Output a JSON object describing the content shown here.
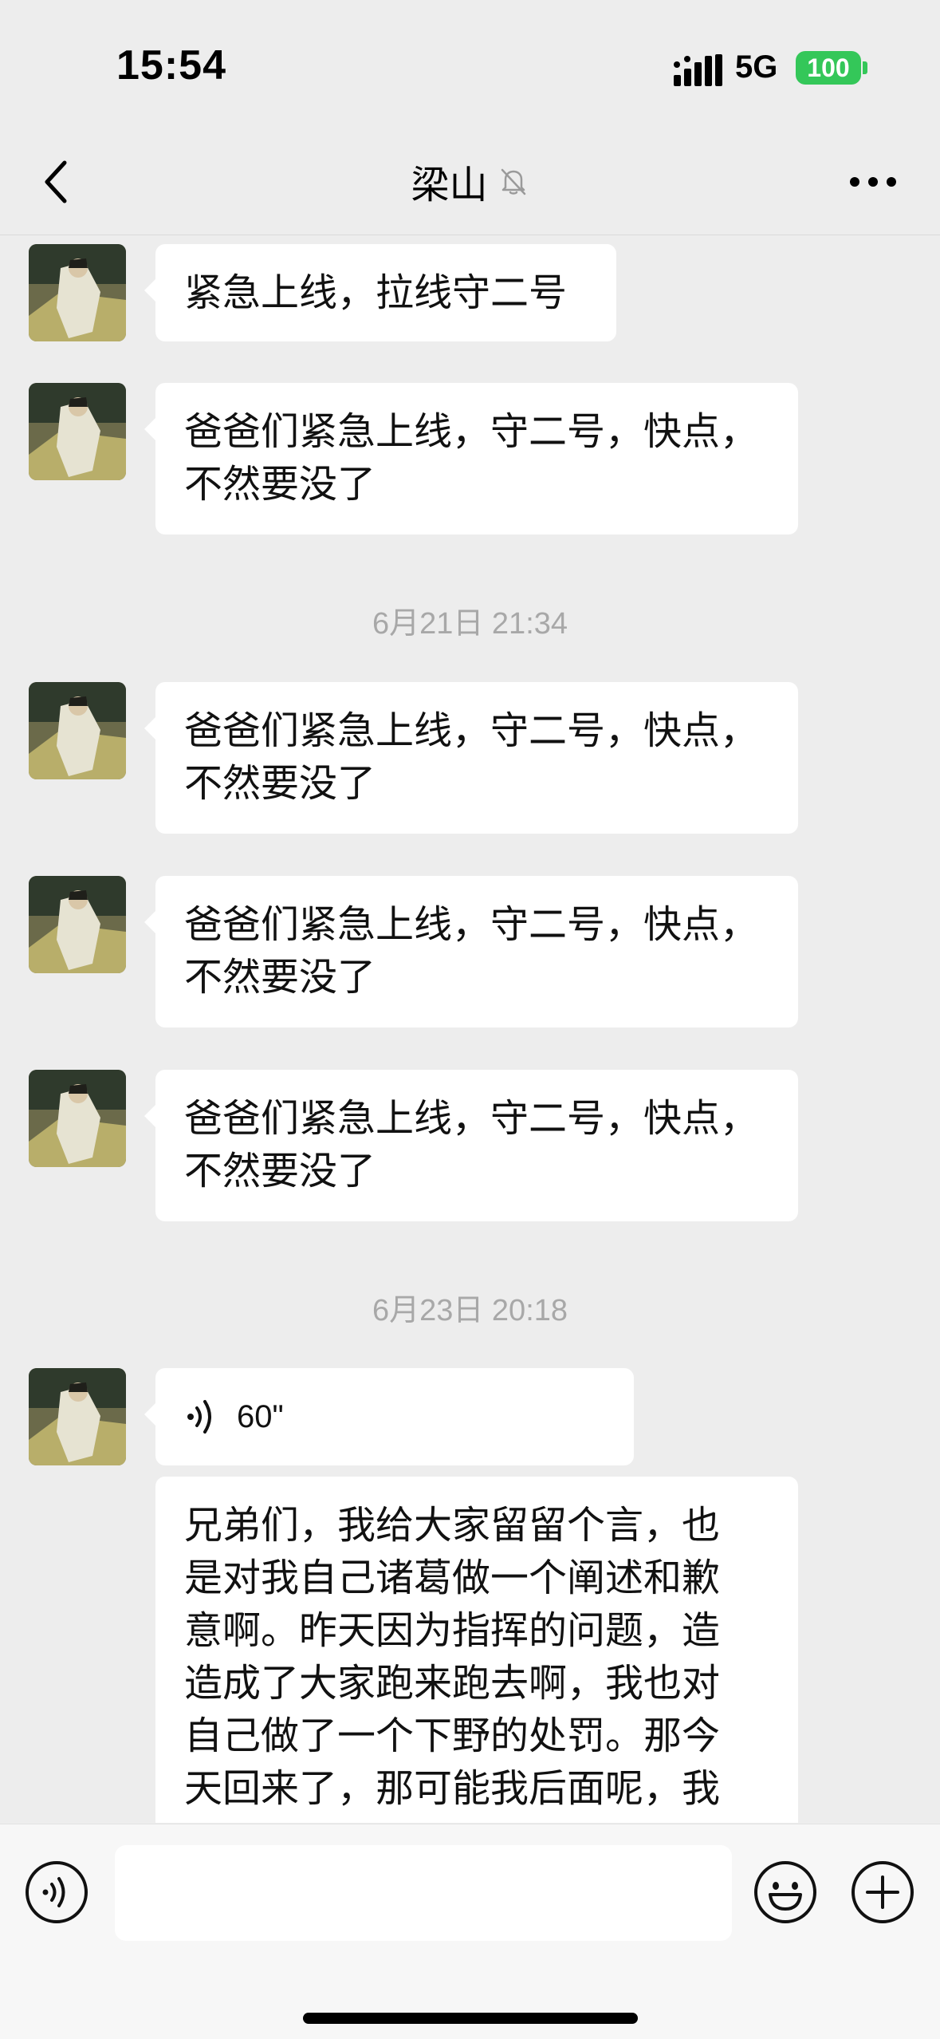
{
  "status_bar": {
    "time": "15:54",
    "network": "5G",
    "battery": "100",
    "battery_color": "#34c759"
  },
  "header": {
    "title": "梁山",
    "back_icon": "chevron-left-icon",
    "mute_icon": "bell-slash-icon",
    "more_icon": "ellipsis-icon"
  },
  "messages": [
    {
      "type": "text",
      "text": "紧急上线，拉线守二号"
    },
    {
      "type": "text",
      "lines": [
        "爸爸们紧急上线，守二号，快点，",
        "不然要没了"
      ]
    },
    {
      "type": "timestamp",
      "text": "6月21日 21:34"
    },
    {
      "type": "text",
      "lines": [
        "爸爸们紧急上线，守二号，快点，",
        "不然要没了"
      ]
    },
    {
      "type": "text",
      "lines": [
        "爸爸们紧急上线，守二号，快点，",
        "不然要没了"
      ]
    },
    {
      "type": "text",
      "lines": [
        "爸爸们紧急上线，守二号，快点，",
        "不然要没了"
      ]
    },
    {
      "type": "timestamp",
      "text": "6月23日 20:18"
    },
    {
      "type": "voice",
      "duration": "60\""
    },
    {
      "type": "transcript",
      "lines": [
        "兄弟们，我给大家留留个言，也",
        "是对我自己诸葛做一个阐述和歉",
        "意啊。昨天因为指挥的问题，造",
        "造成了大家跑来跑去啊，我也对",
        "自己做了一个下野的处罚。那今",
        "天回来了，那可能我后面呢，我"
      ]
    }
  ],
  "input_bar": {
    "voice_icon": "voice-input-icon",
    "emoji_icon": "emoji-icon",
    "plus_icon": "plus-circle-icon"
  }
}
